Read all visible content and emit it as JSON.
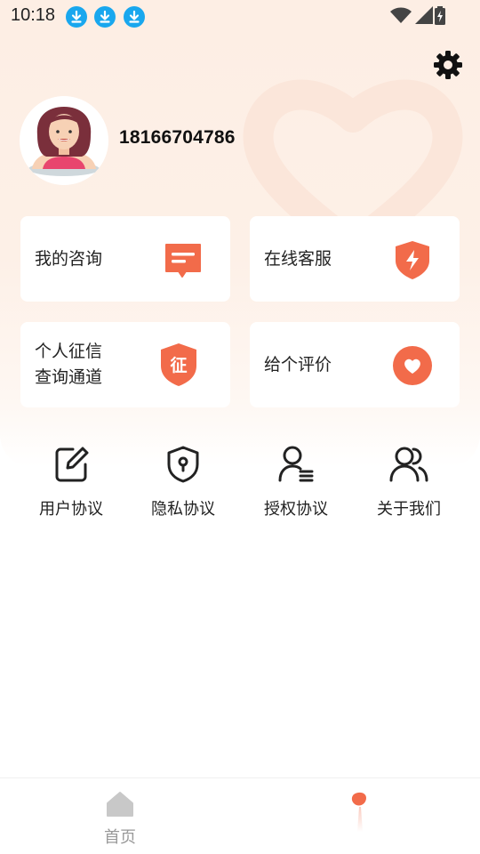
{
  "status_bar": {
    "time": "10:18"
  },
  "user": {
    "phone": "18166704786"
  },
  "cards": [
    {
      "label": "我的咨询",
      "icon": "message-icon"
    },
    {
      "label": "在线客服",
      "icon": "shield-bolt-icon"
    },
    {
      "label_line1": "个人征信",
      "label_line2": "查询通道",
      "icon": "shield-zheng-icon",
      "badge": "征"
    },
    {
      "label": "给个评价",
      "icon": "heart-icon"
    }
  ],
  "quick_links": [
    {
      "label": "用户协议",
      "icon": "edit-icon"
    },
    {
      "label": "隐私协议",
      "icon": "privacy-shield-icon"
    },
    {
      "label": "授权协议",
      "icon": "user-list-icon"
    },
    {
      "label": "关于我们",
      "icon": "users-icon"
    }
  ],
  "tabbar": {
    "home_label": "首页"
  },
  "colors": {
    "accent": "#f26b4a",
    "background_tint": "#fdeee4",
    "download_blue": "#19a7ee"
  }
}
